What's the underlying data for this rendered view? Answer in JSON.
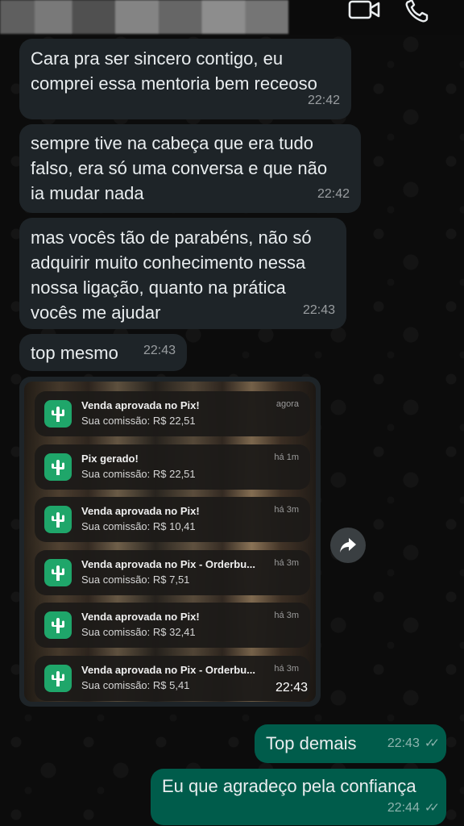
{
  "header": {
    "video_icon": "video-call-icon",
    "phone_icon": "phone-call-icon"
  },
  "messages": [
    {
      "lines": [
        "Cara pra ser sincero contigo, eu",
        "comprei essa mentoria bem receoso"
      ],
      "time": "22:42"
    },
    {
      "lines": [
        "sempre tive na cabeça que era tudo",
        "falso, era só uma conversa e que não",
        "ia mudar nada"
      ],
      "time": "22:42"
    },
    {
      "lines": [
        "mas vocês tão de parabéns, não só",
        "adquirir muito conhecimento nessa",
        "nossa ligação, quanto na prática",
        "vocês me ajudar"
      ],
      "time": "22:43"
    },
    {
      "lines": [
        "top mesmo"
      ],
      "time": "22:43"
    }
  ],
  "image_message": {
    "time": "22:43",
    "notifications": [
      {
        "title": "Venda aprovada no Pix!",
        "body": "Sua comissão: R$ 22,51",
        "age": "agora"
      },
      {
        "title": "Pix gerado!",
        "body": "Sua comissão: R$ 22,51",
        "age": "há 1m"
      },
      {
        "title": "Venda aprovada no Pix!",
        "body": "Sua comissão: R$ 10,41",
        "age": "há 3m"
      },
      {
        "title": "Venda aprovada no Pix - Orderbu...",
        "body": "Sua comissão: R$ 7,51",
        "age": "há 3m"
      },
      {
        "title": "Venda aprovada no Pix!",
        "body": "Sua comissão: R$ 32,41",
        "age": "há 3m"
      },
      {
        "title": "Venda aprovada no Pix - Orderbu...",
        "body": "Sua comissão: R$ 5,41",
        "age": "há 3m"
      }
    ]
  },
  "outgoing": [
    {
      "text": "Top demais",
      "time": "22:43"
    },
    {
      "text": "Eu que agradeço pela confiança",
      "time": "22:44"
    }
  ],
  "colors": {
    "incoming_bubble": "#1e2428",
    "outgoing_bubble": "#005c4b",
    "app_icon_green": "#1fa66a"
  }
}
